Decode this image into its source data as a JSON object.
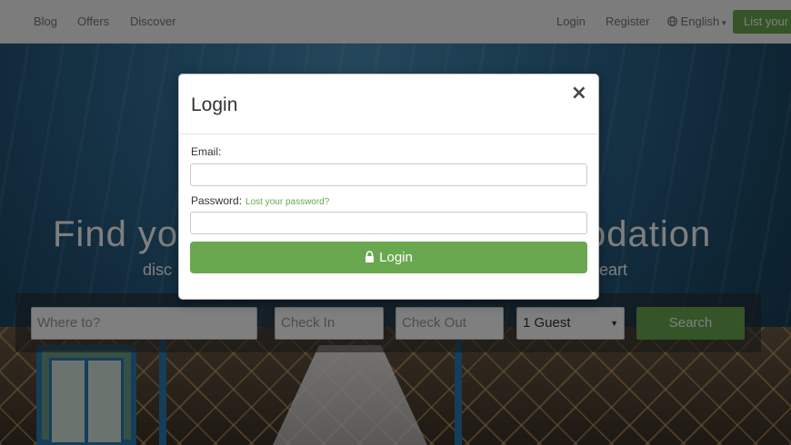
{
  "navbar": {
    "left_links": [
      "Blog",
      "Offers",
      "Discover"
    ],
    "login": "Login",
    "register": "Register",
    "language": "English",
    "list_button": "List your"
  },
  "hero": {
    "title_left": "Find yo",
    "title_right": "odation",
    "subtitle_left": "disc",
    "subtitle_right": "eart"
  },
  "search": {
    "where_placeholder": "Where to?",
    "checkin_placeholder": "Check In",
    "checkout_placeholder": "Check Out",
    "guests_value": "1 Guest",
    "button": "Search"
  },
  "modal": {
    "title": "Login",
    "close_glyph": "×",
    "email_label": "Email:",
    "email_value": "",
    "password_label": "Password:",
    "password_value": "",
    "lost_password": "Lost your password?",
    "submit": "Login"
  },
  "colors": {
    "accent_green": "#6aa84f",
    "overlay": "rgba(0,0,0,0.5)"
  }
}
